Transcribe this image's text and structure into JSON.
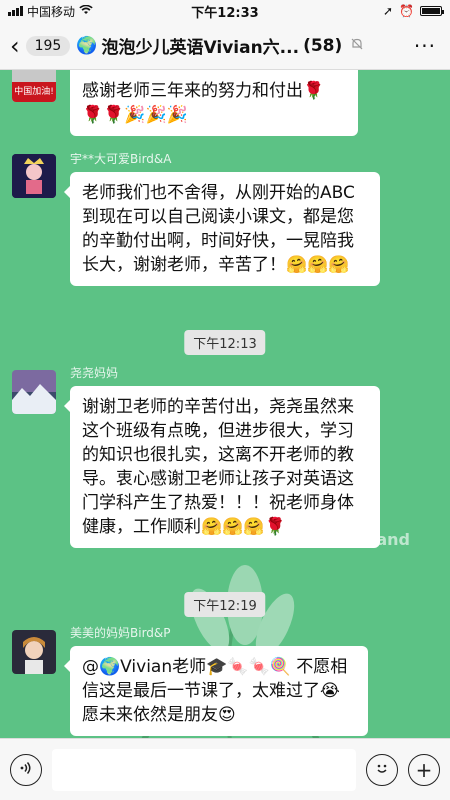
{
  "status_bar": {
    "carrier": "中国移动",
    "time": "下午12:33"
  },
  "nav": {
    "unread_count": "195",
    "title": "泡泡少儿英语Vivian六...",
    "member_count": "(58)"
  },
  "messages": [
    {
      "sender": "",
      "avatar_text": "中国加油!",
      "text": "感谢老师三年来的努力和付出🌹",
      "text2": "🌹🌹🎉🎉🎉"
    },
    {
      "sender": "宇**大可爱Bird&A",
      "text": "老师我们也不舍得，从刚开始的ABC到现在可以自己阅读小课文，都是您的辛勤付出啊，时间好快，一晃陪我长大，谢谢老师，辛苦了！🤗🤗🤗"
    },
    {
      "time": "下午12:13"
    },
    {
      "sender": "尧尧妈妈",
      "text": "谢谢卫老师的辛苦付出，尧尧虽然来这个班级有点晚，但进步很大，学习的知识也很扎实，这离不开老师的教导。衷心感谢卫老师让孩子对英语这门学科产生了热爱！！！祝老师身体健康，工作顺利🤗🤗🤗🌹"
    },
    {
      "time": "下午12:19"
    },
    {
      "sender": "美美的妈妈Bird&P",
      "text": "@🌍Vivian老师🎓🍬🍬🍭 不愿相信这是最后一节课了，太难过了😭愿未来依然是朋友😍"
    }
  ],
  "background_word": "and",
  "input": {
    "placeholder": ""
  },
  "colors": {
    "chat_background": "#5cc285",
    "bubble": "#ffffff",
    "bar": "#f7f7f7"
  },
  "icons": {
    "voice": "voice-icon",
    "emoji": "emoji-icon",
    "plus": "plus-icon",
    "back": "chevron-left-icon",
    "mute": "mute-bell-icon",
    "more": "more-icon"
  }
}
